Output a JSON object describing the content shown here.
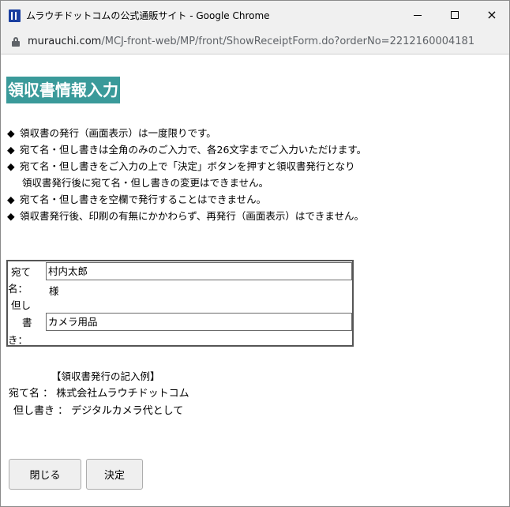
{
  "window": {
    "title": "ムラウチドットコムの公式通販サイト - Google Chrome",
    "icon": "muranet-logo-icon",
    "controls": {
      "minimize": "minimize-icon",
      "maximize": "maximize-icon",
      "close": "×"
    }
  },
  "address": {
    "host": "murauchi.com",
    "path": "/MCJ-front-web/MP/front/ShowReceiptForm.do?orderNo=2212160004181"
  },
  "page": {
    "title": "領収書情報入力",
    "title_bg": "#3a9a9a"
  },
  "notes": {
    "bullet": "◆",
    "items": [
      "領収書の発行（画面表示）は一度限りです。",
      "宛て名・但し書きは全角のみのご入力で、各26文字までご入力いただけます。",
      "宛て名・但し書きをご入力の上で「決定」ボタンを押すと領収書発行となり",
      "宛て名・但し書きを空欄で発行することはできません。",
      "領収書発行後、印刷の有無にかかわらず、再発行（画面表示）はできません。"
    ],
    "continuation": "領収書発行後に宛て名・但し書きの変更はできません。"
  },
  "form": {
    "addressee": {
      "label_line1": "宛て",
      "label_line2": "名：",
      "value": "村内太郎",
      "suffix": "様"
    },
    "proviso": {
      "label_line1": "但し",
      "label_line2": "書",
      "label_line3": "き：",
      "value": "カメラ用品"
    }
  },
  "example": {
    "heading": "【領収書発行の記入例】",
    "addressee_line": "宛て名 ： 株式会社ムラウチドットコム",
    "proviso_line": "但し書き ： デジタルカメラ代として"
  },
  "buttons": {
    "close": "閉じる",
    "ok": "決定"
  }
}
